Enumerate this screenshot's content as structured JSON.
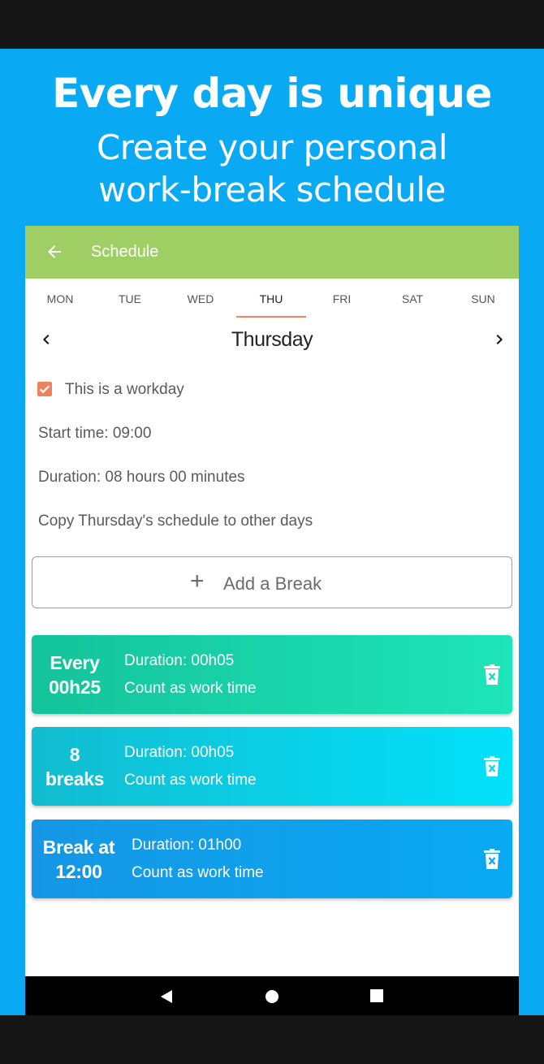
{
  "promo": {
    "headline": "Every day is unique",
    "subhead_line1": "Create your personal",
    "subhead_line2": "work-break schedule"
  },
  "appbar": {
    "title": "Schedule",
    "back_icon": "arrow-left-icon"
  },
  "days": [
    {
      "label": "MON",
      "active": false
    },
    {
      "label": "TUE",
      "active": false
    },
    {
      "label": "WED",
      "active": false
    },
    {
      "label": "THU",
      "active": true
    },
    {
      "label": "FRI",
      "active": false
    },
    {
      "label": "SAT",
      "active": false
    },
    {
      "label": "SUN",
      "active": false
    }
  ],
  "day_view": {
    "heading": "Thursday",
    "prev_icon": "chevron-left-icon",
    "next_icon": "chevron-right-icon",
    "workday_label": "This is a workday",
    "workday_checked": true,
    "start_time": "Start time: 09:00",
    "duration": "Duration: 08 hours 00 minutes",
    "copy_schedule": "Copy Thursday's schedule to other days"
  },
  "add_break": {
    "plus": "+",
    "label": "Add a Break"
  },
  "breaks": [
    {
      "left_line1": "Every",
      "left_line2": "00h25",
      "duration": "Duration: 00h05",
      "note": "Count as work time",
      "icon": "trash-icon",
      "colors": [
        "#14c39a",
        "#1ee4ba"
      ]
    },
    {
      "left_line1": "8",
      "left_line2": "breaks",
      "duration": "Duration: 00h05",
      "note": "Count as work time",
      "icon": "trash-icon",
      "colors": [
        "#12bcd0",
        "#02e1fa"
      ]
    },
    {
      "left_line1": "Break at",
      "left_line2": "12:00",
      "duration": "Duration: 01h00",
      "note": "Count as work time",
      "icon": "trash-icon",
      "colors": [
        "#1597e5",
        "#0aa9f3"
      ]
    }
  ],
  "colors": {
    "promo_bg": "#0aa9f3",
    "appbar": "#9fcf64",
    "accent": "#f0815d"
  },
  "system_nav": [
    "back-triangle-icon",
    "home-circle-icon",
    "recents-square-icon"
  ]
}
